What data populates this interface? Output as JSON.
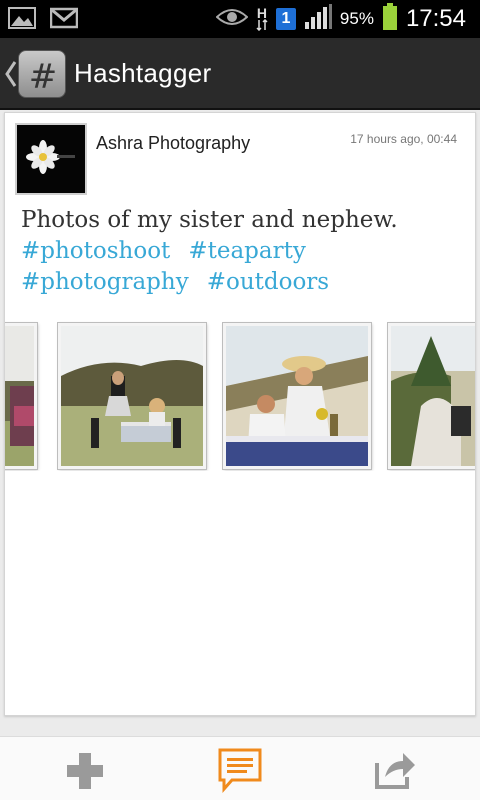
{
  "status_bar": {
    "network_type": "H",
    "sim_slot": "1",
    "battery_percent": "95%",
    "time": "17:54",
    "icons": [
      "picture-icon",
      "gmail-icon",
      "eye-icon",
      "network-h-icon",
      "sim-1-icon",
      "signal-icon",
      "battery-icon"
    ]
  },
  "action_bar": {
    "title": "Hashtagger",
    "logo_glyph": "#"
  },
  "post": {
    "author": "Ashra Photography",
    "timestamp": "17 hours ago, 00:44",
    "text": "Photos of my sister and nephew.",
    "hashtags": [
      "#photoshoot",
      "#teaparty",
      "#photography",
      "#outdoors"
    ],
    "thumbnails": [
      "photo-1",
      "photo-2",
      "photo-3",
      "photo-4"
    ]
  },
  "bottom_bar": {
    "buttons": [
      "add-icon",
      "comment-icon",
      "share-icon"
    ]
  },
  "colors": {
    "hashtag": "#38a8d6",
    "accent_orange": "#f08a1c",
    "action_bar": "#2a2a2a"
  }
}
